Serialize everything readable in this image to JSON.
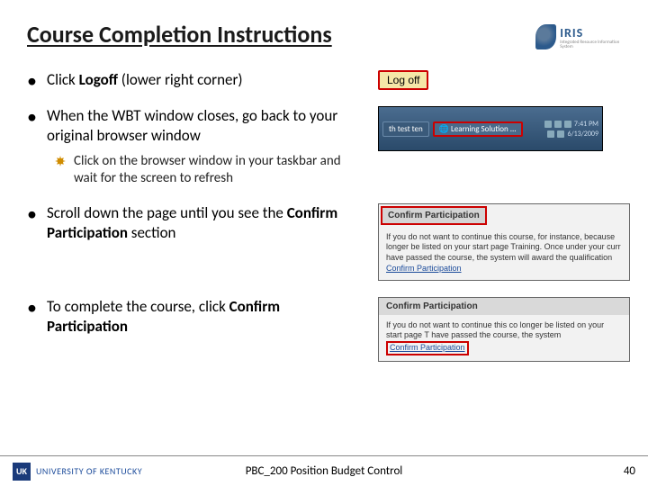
{
  "title": "Course Completion Instructions",
  "logo": {
    "text": "IRIS",
    "subtitle": "Integrated Resource Information System"
  },
  "bullets": {
    "b1_pre": "Click ",
    "b1_bold": "Logoff",
    "b1_post": " (lower right corner)",
    "b2": "When the WBT window closes, go back to your original browser window",
    "b2_sub": "Click on the browser window in your taskbar and wait for the screen to refresh",
    "b3_pre": "Scroll down the page until you see the ",
    "b3_bold": "Confirm Participation",
    "b3_post": " section",
    "b4_pre": "To complete the course, click ",
    "b4_bold": "Confirm Participation"
  },
  "mock": {
    "logoff": "Log off",
    "task_item1": "th test ten",
    "task_item2": "Learning Solution ...",
    "time": "7:41 PM",
    "date": "6/13/2009",
    "confirm_title": "Confirm Participation",
    "confirm_text1": "If you do not want to continue this course, for instance, because longer be listed on your start page Training. Once under your curr have passed the course, the system will award the qualification",
    "confirm_link": "Confirm Participation",
    "confirm_text2": "If you do not want to continue this co longer be listed on your start page T have passed the course, the system"
  },
  "footer": {
    "uk_mark": "UK",
    "uk_text": "UNIVERSITY OF KENTUCKY",
    "title": "PBC_200 Position Budget Control",
    "page": "40"
  }
}
